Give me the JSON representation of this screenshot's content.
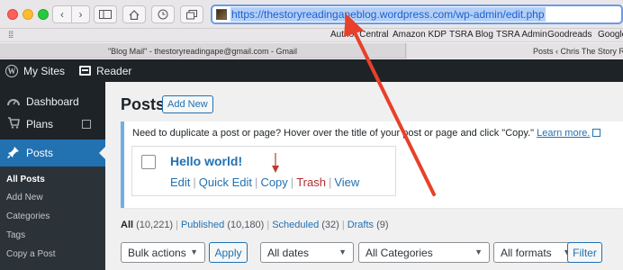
{
  "browser": {
    "url": "https://thestoryreadingapeblog.wordpress.com/wp-admin/edit.php",
    "bookmarks": [
      "Author Central",
      "Amazon KDP",
      "TSRA Blog",
      "TSRA Admin",
      "Goodreads",
      "Google"
    ],
    "tabs": [
      "\"Blog Mail\" - thestoryreadingape@gmail.com - Gmail",
      "Posts ‹ Chris The Story R"
    ]
  },
  "adminbar": {
    "my_sites": "My Sites",
    "reader": "Reader"
  },
  "sidebar": {
    "items": [
      {
        "label": "Dashboard",
        "icon": "dashboard-icon"
      },
      {
        "label": "Plans",
        "icon": "cart-icon"
      },
      {
        "label": "Posts",
        "icon": "pin-icon"
      }
    ],
    "submenu": [
      "All Posts",
      "Add New",
      "Categories",
      "Tags",
      "Copy a Post"
    ]
  },
  "main": {
    "title": "Posts",
    "add_new": "Add New",
    "notice": {
      "text": "Need to duplicate a post or page? Hover over the title of your post or page and click \"Copy.\"",
      "link": "Learn more."
    },
    "demo": {
      "title": "Hello world!",
      "actions": [
        "Edit",
        "Quick Edit",
        "Copy",
        "Trash",
        "View"
      ]
    },
    "views": [
      {
        "label": "All",
        "count": "(10,221)"
      },
      {
        "label": "Published",
        "count": "(10,180)"
      },
      {
        "label": "Scheduled",
        "count": "(32)"
      },
      {
        "label": "Drafts",
        "count": "(9)"
      }
    ],
    "filters": {
      "bulk_actions": "Bulk actions",
      "apply": "Apply",
      "dates": "All dates",
      "categories": "All Categories",
      "formats": "All formats",
      "filter": "Filter"
    }
  },
  "colors": {
    "annotation_arrow": "#e8402a",
    "admin_blue": "#2271b1",
    "admin_dark": "#1d2327"
  }
}
